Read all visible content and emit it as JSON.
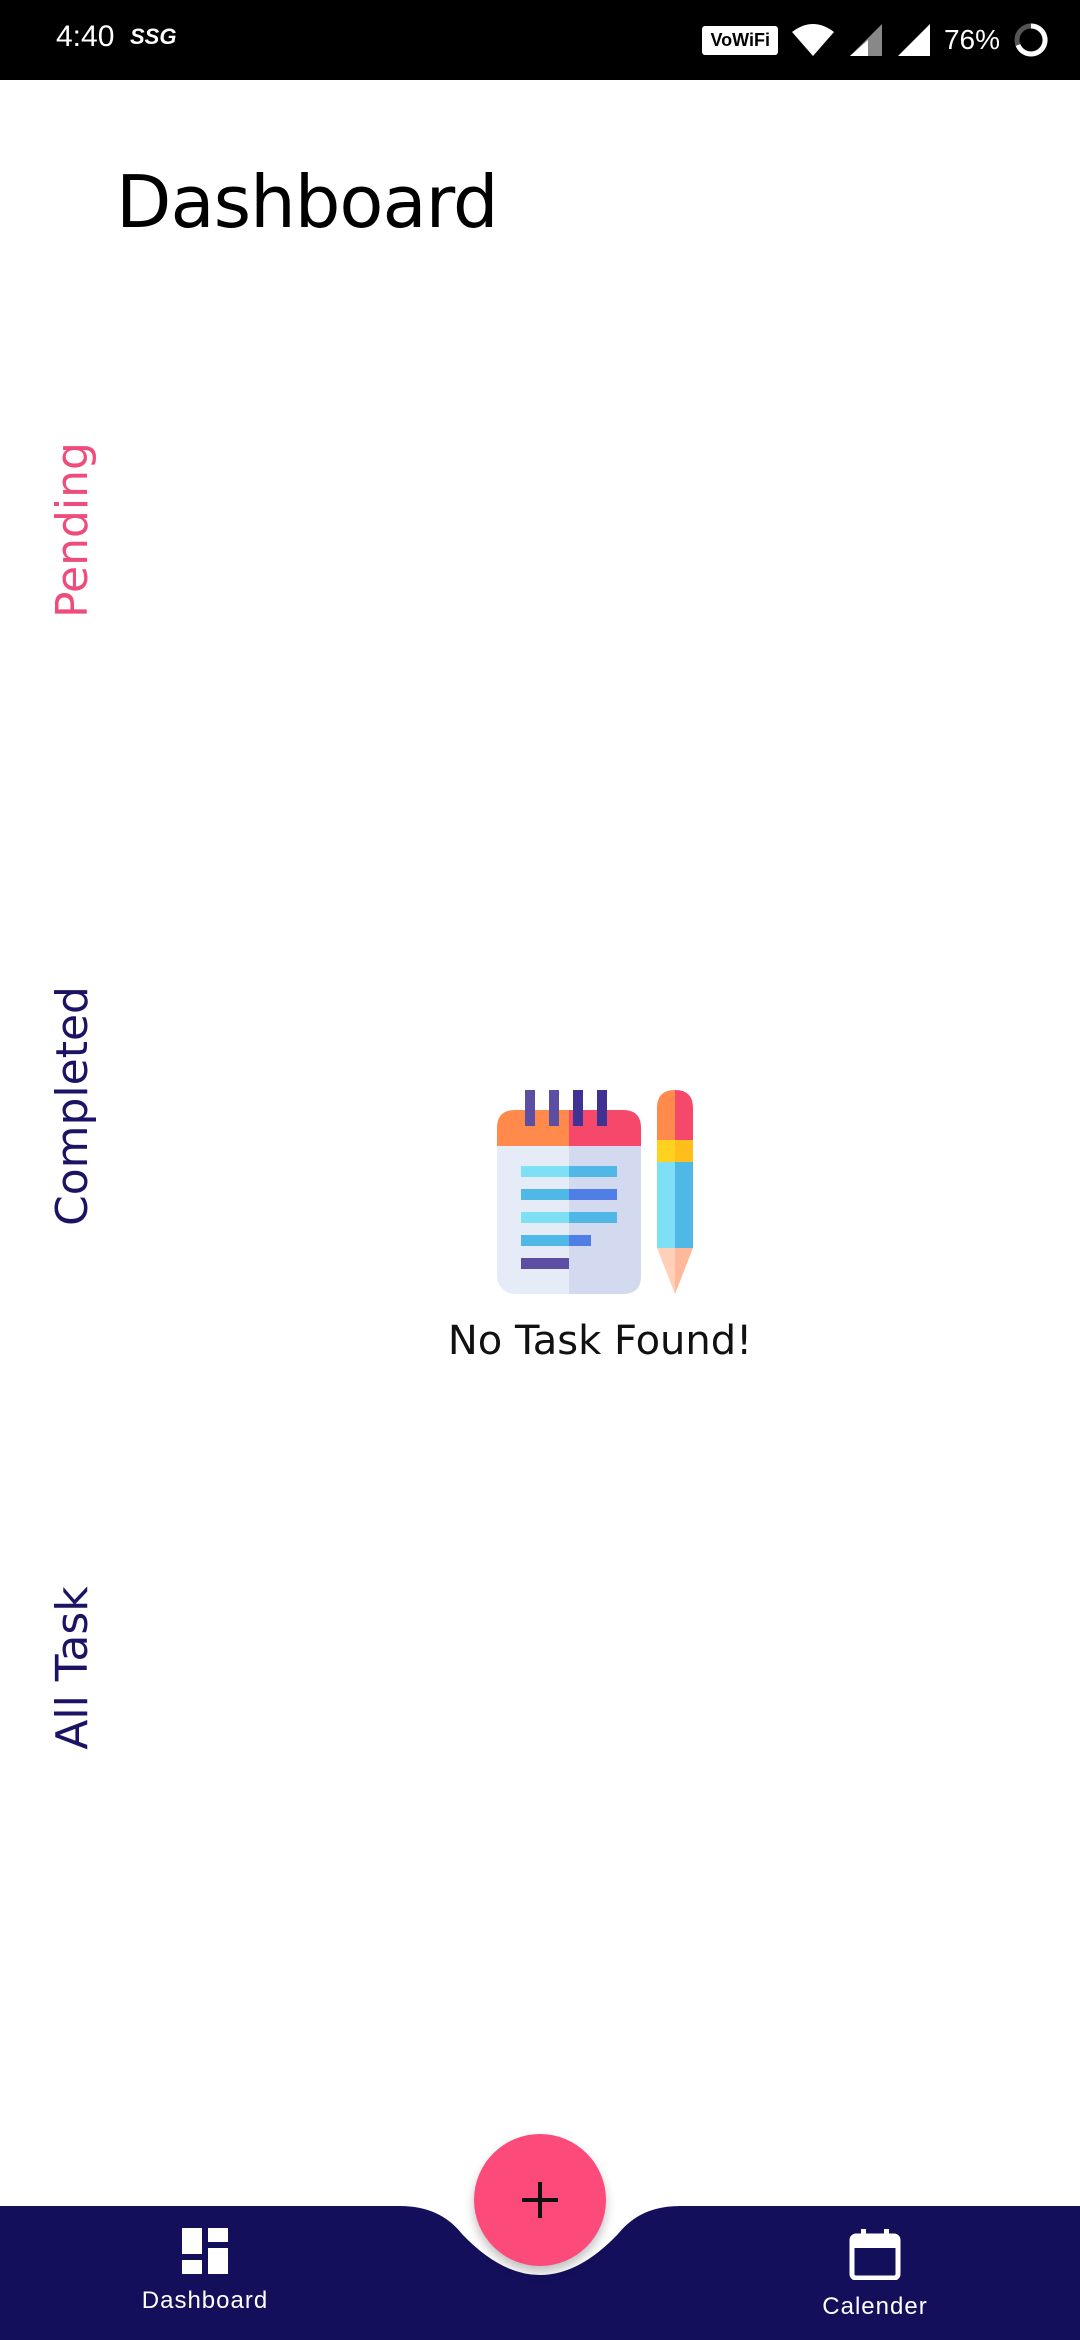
{
  "status_bar": {
    "time": "4:40",
    "carrier": "SSG",
    "vowifi": "VoWiFi",
    "battery": "76%"
  },
  "header": {
    "title": "Dashboard"
  },
  "tabs": [
    {
      "label": "Pending",
      "color": "#ee4d7b",
      "active": true
    },
    {
      "label": "Completed",
      "color": "#1b1464",
      "active": false
    },
    {
      "label": "All Task",
      "color": "#1b1464",
      "active": false
    }
  ],
  "empty_state": {
    "icon": "notepad-pencil-illustration",
    "message": "No Task Found!"
  },
  "fab": {
    "icon": "plus-icon",
    "color": "#fc4b7a"
  },
  "bottom_nav": {
    "background": "#130f5a",
    "items": [
      {
        "label": "Dashboard",
        "icon": "dashboard-icon"
      },
      {
        "label": "Calender",
        "icon": "calendar-icon"
      }
    ]
  }
}
